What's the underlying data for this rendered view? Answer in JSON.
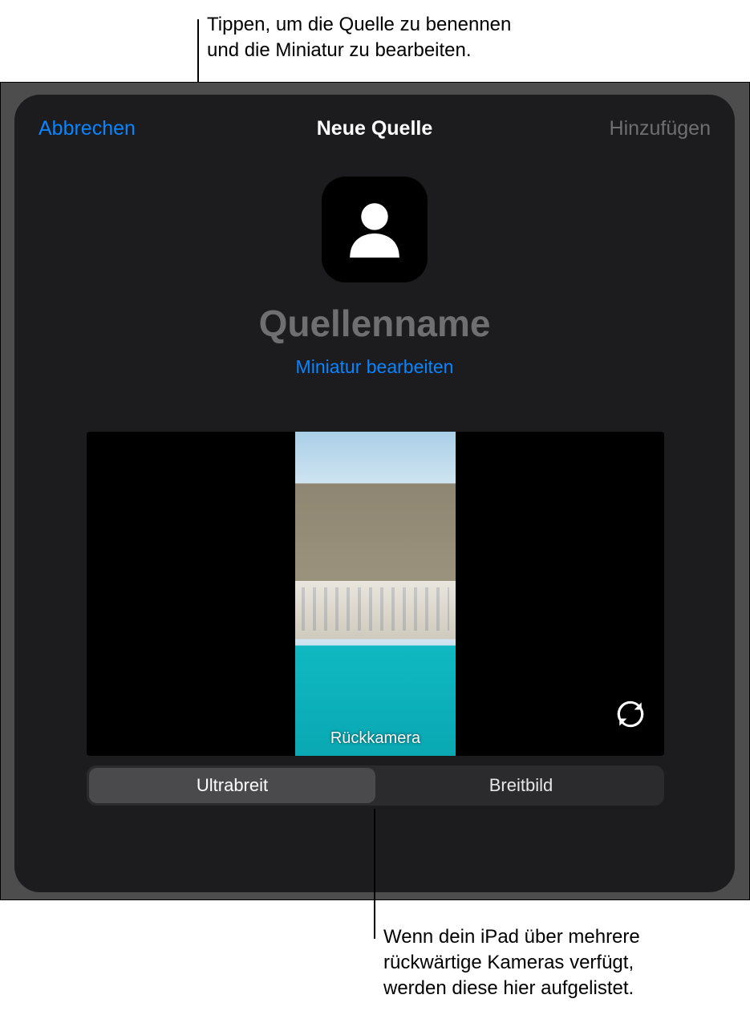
{
  "callouts": {
    "top_line1": "Tippen, um die Quelle zu benennen",
    "top_line2": "und die Miniatur zu bearbeiten.",
    "bottom_line1": "Wenn dein iPad über mehrere",
    "bottom_line2": "rückwärtige Kameras verfügt,",
    "bottom_line3": "werden diese hier aufgelistet."
  },
  "sheet": {
    "title": "Neue Quelle",
    "cancel": "Abbrechen",
    "add": "Hinzufügen",
    "source_name_placeholder": "Quellenname",
    "edit_thumbnail": "Miniatur bearbeiten",
    "camera_label": "Rückkamera"
  },
  "segments": {
    "ultrawide": "Ultrabreit",
    "wide": "Breitbild",
    "selected": "ultrawide"
  },
  "icons": {
    "avatar": "person-icon",
    "switch_camera": "camera-switch-icon"
  },
  "colors": {
    "link": "#0a84ff",
    "sheet_bg": "#1c1c1e",
    "disabled_text": "#6f6f72"
  }
}
